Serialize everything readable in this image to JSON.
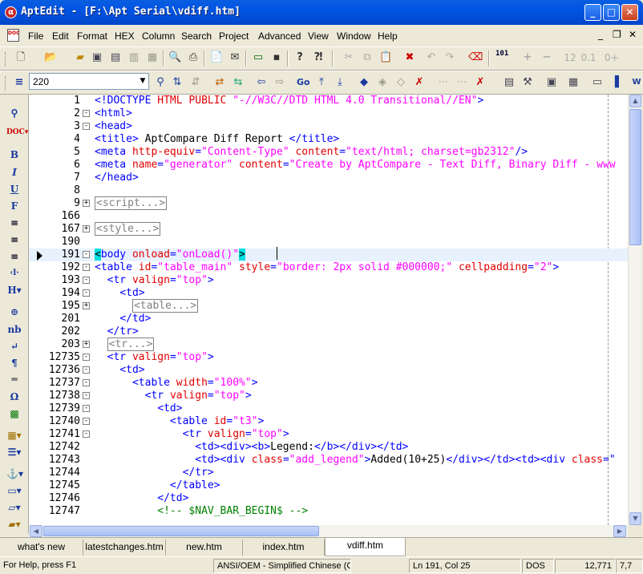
{
  "window": {
    "title": "AptEdit - [F:\\Apt Serial\\vdiff.htm]",
    "minimize": "_",
    "maximize": "□",
    "close": "✕"
  },
  "menu": [
    "File",
    "Edit",
    "Format",
    "HEX",
    "Column",
    "Search",
    "Project",
    "Advanced",
    "View",
    "Window",
    "Help"
  ],
  "mdi_controls": {
    "minimize": "_",
    "restore": "❐",
    "close": "✕"
  },
  "toolbar2": {
    "zoom_value": "220"
  },
  "toolbar_labels": {
    "numbers": "12",
    "decimal": "0.1",
    "binary": "101"
  },
  "editor": {
    "lines": [
      {
        "n": "1",
        "fold": "",
        "segs": [
          [
            "t",
            "<!DOCTYPE "
          ],
          [
            "a",
            "HTML PUBLIC "
          ],
          [
            "s",
            "\"-//W3C//DTD HTML 4.0 Transitional//EN\""
          ],
          [
            "t",
            ">"
          ]
        ]
      },
      {
        "n": "2",
        "fold": "-",
        "segs": [
          [
            "t",
            "<html>"
          ]
        ]
      },
      {
        "n": "3",
        "fold": "-",
        "segs": [
          [
            "t",
            "<head>"
          ]
        ]
      },
      {
        "n": "4",
        "fold": "",
        "segs": [
          [
            "t",
            "<title> "
          ],
          [
            "x",
            "AptCompare Diff Report "
          ],
          [
            "t",
            "</title>"
          ]
        ]
      },
      {
        "n": "5",
        "fold": "",
        "segs": [
          [
            "t",
            "<meta "
          ],
          [
            "a",
            "http-equiv"
          ],
          [
            "t",
            "="
          ],
          [
            "s",
            "\"Content-Type\""
          ],
          [
            "a",
            " content"
          ],
          [
            "t",
            "="
          ],
          [
            "s",
            "\"text/html; charset=gb2312\""
          ],
          [
            "t",
            "/>"
          ]
        ]
      },
      {
        "n": "6",
        "fold": "",
        "segs": [
          [
            "t",
            "<meta "
          ],
          [
            "a",
            "name"
          ],
          [
            "t",
            "="
          ],
          [
            "s",
            "\"generator\""
          ],
          [
            "a",
            " content"
          ],
          [
            "t",
            "="
          ],
          [
            "s",
            "\"Create by AptCompare - Text Diff, Binary Diff - www"
          ]
        ]
      },
      {
        "n": "7",
        "fold": "",
        "segs": [
          [
            "t",
            "</head>"
          ]
        ]
      },
      {
        "n": "8",
        "fold": "",
        "segs": []
      },
      {
        "n": "9",
        "fold": "+",
        "segs": [
          [
            "col",
            "<script...>"
          ]
        ]
      },
      {
        "n": "166",
        "fold": "",
        "segs": []
      },
      {
        "n": "167",
        "fold": "+",
        "segs": [
          [
            "col",
            "<style...>"
          ]
        ]
      },
      {
        "n": "190",
        "fold": "",
        "segs": []
      },
      {
        "n": "191",
        "fold": "-",
        "cur": true,
        "segs": [
          [
            "hl",
            "<"
          ],
          [
            "t",
            "body "
          ],
          [
            "a",
            "onload"
          ],
          [
            "t",
            "="
          ],
          [
            "s",
            "\"onLoad()\""
          ],
          [
            "hl",
            ">"
          ]
        ]
      },
      {
        "n": "192",
        "fold": "-",
        "segs": [
          [
            "t",
            "<table "
          ],
          [
            "a",
            "id"
          ],
          [
            "t",
            "="
          ],
          [
            "s",
            "\"table_main\""
          ],
          [
            "a",
            " style"
          ],
          [
            "t",
            "="
          ],
          [
            "s",
            "\"border: 2px solid #000000;\""
          ],
          [
            "a",
            " cellpadding"
          ],
          [
            "t",
            "="
          ],
          [
            "s",
            "\"2\""
          ],
          [
            "t",
            ">"
          ]
        ]
      },
      {
        "n": "193",
        "fold": "-",
        "segs": [
          [
            "x",
            "  "
          ],
          [
            "t",
            "<tr "
          ],
          [
            "a",
            "valign"
          ],
          [
            "t",
            "="
          ],
          [
            "s",
            "\"top\""
          ],
          [
            "t",
            ">"
          ]
        ]
      },
      {
        "n": "194",
        "fold": "-",
        "segs": [
          [
            "x",
            "    "
          ],
          [
            "t",
            "<td>"
          ]
        ]
      },
      {
        "n": "195",
        "fold": "+",
        "segs": [
          [
            "x",
            "      "
          ],
          [
            "col",
            "<table...>"
          ]
        ]
      },
      {
        "n": "201",
        "fold": "",
        "segs": [
          [
            "x",
            "    "
          ],
          [
            "t",
            "</td>"
          ]
        ]
      },
      {
        "n": "202",
        "fold": "",
        "segs": [
          [
            "x",
            "  "
          ],
          [
            "t",
            "</tr>"
          ]
        ]
      },
      {
        "n": "203",
        "fold": "+",
        "segs": [
          [
            "x",
            "  "
          ],
          [
            "col",
            "<tr...>"
          ]
        ]
      },
      {
        "n": "12735",
        "fold": "-",
        "segs": [
          [
            "x",
            "  "
          ],
          [
            "t",
            "<tr "
          ],
          [
            "a",
            "valign"
          ],
          [
            "t",
            "="
          ],
          [
            "s",
            "\"top\""
          ],
          [
            "t",
            ">"
          ]
        ]
      },
      {
        "n": "12736",
        "fold": "-",
        "segs": [
          [
            "x",
            "    "
          ],
          [
            "t",
            "<td>"
          ]
        ]
      },
      {
        "n": "12737",
        "fold": "-",
        "segs": [
          [
            "x",
            "      "
          ],
          [
            "t",
            "<table "
          ],
          [
            "a",
            "width"
          ],
          [
            "t",
            "="
          ],
          [
            "s",
            "\"100%\""
          ],
          [
            "t",
            ">"
          ]
        ]
      },
      {
        "n": "12738",
        "fold": "-",
        "segs": [
          [
            "x",
            "        "
          ],
          [
            "t",
            "<tr "
          ],
          [
            "a",
            "valign"
          ],
          [
            "t",
            "="
          ],
          [
            "s",
            "\"top\""
          ],
          [
            "t",
            ">"
          ]
        ]
      },
      {
        "n": "12739",
        "fold": "-",
        "segs": [
          [
            "x",
            "          "
          ],
          [
            "t",
            "<td>"
          ]
        ]
      },
      {
        "n": "12740",
        "fold": "-",
        "segs": [
          [
            "x",
            "            "
          ],
          [
            "t",
            "<table "
          ],
          [
            "a",
            "id"
          ],
          [
            "t",
            "="
          ],
          [
            "s",
            "\"t3\""
          ],
          [
            "t",
            ">"
          ]
        ]
      },
      {
        "n": "12741",
        "fold": "-",
        "segs": [
          [
            "x",
            "              "
          ],
          [
            "t",
            "<tr "
          ],
          [
            "a",
            "valign"
          ],
          [
            "t",
            "="
          ],
          [
            "s",
            "\"top\""
          ],
          [
            "t",
            ">"
          ]
        ]
      },
      {
        "n": "12742",
        "fold": "",
        "segs": [
          [
            "x",
            "                "
          ],
          [
            "t",
            "<td><div><b>"
          ],
          [
            "x",
            "Legend:"
          ],
          [
            "t",
            "</b></div></td>"
          ]
        ]
      },
      {
        "n": "12743",
        "fold": "",
        "segs": [
          [
            "x",
            "                "
          ],
          [
            "t",
            "<td><div "
          ],
          [
            "a",
            "class"
          ],
          [
            "t",
            "="
          ],
          [
            "s",
            "\"add_legend\""
          ],
          [
            "t",
            ">"
          ],
          [
            "x",
            "Added(10+25)"
          ],
          [
            "t",
            "</div></td><td><div "
          ],
          [
            "a",
            "class"
          ],
          [
            "t",
            "=\""
          ]
        ]
      },
      {
        "n": "12744",
        "fold": "",
        "segs": [
          [
            "x",
            "              "
          ],
          [
            "t",
            "</tr>"
          ]
        ]
      },
      {
        "n": "12745",
        "fold": "",
        "segs": [
          [
            "x",
            "            "
          ],
          [
            "t",
            "</table>"
          ]
        ]
      },
      {
        "n": "12746",
        "fold": "",
        "segs": [
          [
            "x",
            "          "
          ],
          [
            "t",
            "</td>"
          ]
        ]
      },
      {
        "n": "12747",
        "fold": "",
        "segs": [
          [
            "x",
            "          "
          ],
          [
            "c",
            "<!-- $NAV_BAR_BEGIN$ -->"
          ]
        ]
      }
    ]
  },
  "tabs": [
    "what's new",
    "latestchanges.htm",
    "new.htm",
    "index.htm",
    "vdiff.htm"
  ],
  "active_tab": "vdiff.htm",
  "status": {
    "help": "For Help, press F1",
    "encoding": "ANSI/OEM - Simplified Chinese (GB",
    "position": "Ln 191, Col 25",
    "format": "DOS",
    "size": "12,771",
    "extra": "7,7"
  }
}
